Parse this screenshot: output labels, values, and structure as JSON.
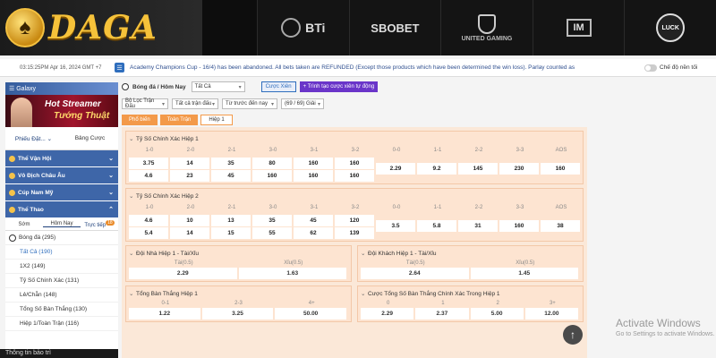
{
  "header": {
    "logo_text": "DAGA",
    "brands": [
      "BTi",
      "SBOBET",
      "UNITED GAMING",
      "IM",
      "LUCK"
    ]
  },
  "announcement": {
    "timestamp": "03:15:25PM Apr 16, 2024 GMT +7",
    "text": "Academy Champions Cup - 16/4) has been abandoned. All bets taken are REFUNDED (Except those products which have been determined the win loss). Parlay counted as",
    "toggle_label": "Chế độ nền tối"
  },
  "sidebar": {
    "galaxy_label": "Galaxy",
    "banner_line1": "Hot Streamer",
    "banner_line2": "Tướng Thuật",
    "tabs": [
      "Phiếu Đặt...",
      "Bảng Cược"
    ],
    "sections": [
      "Thể Vận Hội",
      "Vô Địch Châu Âu",
      "Cúp Nam Mỹ",
      "Thể Thao"
    ],
    "sub_tabs": [
      "Sớm",
      "Hôm Nay",
      "Trực tiếp"
    ],
    "live_badge": "18",
    "sport": "Bóng đá",
    "sport_count": "(295)",
    "categories": [
      "Tất Cả (190)",
      "1X2 (149)",
      "Tỷ Số Chính Xác (131)",
      "Lẻ/Chẵn (148)",
      "Tổng Số Bàn Thắng (130)",
      "Hiệp 1/Toàn Trận (116)"
    ],
    "footer": "Thông tin bảo trì"
  },
  "main": {
    "title": "Bóng đá / Hôm Nay",
    "select_all": "Tất Cả",
    "parlay_btn": "Cược Xiên",
    "auto_btn": "Trình tạo cược xiên tự động",
    "filters": [
      "Bộ Lọc Trận Đấu",
      "Tất cả trận đấu",
      "Từ trước đến nay",
      "(69 / 69) Giải"
    ],
    "sub_tabs": [
      "Phổ biến",
      "Toàn Trận",
      "Hiệp 1"
    ]
  },
  "correct_score_1": {
    "title": "Tỷ Số Chính Xác Hiệp 1",
    "home_headers": [
      "1-0",
      "2-0",
      "2-1",
      "3-0",
      "3-1",
      "3-2"
    ],
    "home_row1": [
      "3.75",
      "14",
      "35",
      "80",
      "160",
      "160"
    ],
    "home_row2": [
      "4.6",
      "23",
      "45",
      "160",
      "160",
      "160"
    ],
    "draw_headers": [
      "0-0",
      "1-1",
      "2-2",
      "3-3",
      "AOS"
    ],
    "draw_row": [
      "2.29",
      "9.2",
      "145",
      "230",
      "160"
    ]
  },
  "correct_score_2": {
    "title": "Tỷ Số Chính Xác Hiệp 2",
    "home_headers": [
      "1-0",
      "2-0",
      "2-1",
      "3-0",
      "3-1",
      "3-2"
    ],
    "home_row1": [
      "4.6",
      "10",
      "13",
      "35",
      "45",
      "120"
    ],
    "home_row2": [
      "5.4",
      "14",
      "15",
      "55",
      "62",
      "139"
    ],
    "draw_headers": [
      "0-0",
      "1-1",
      "2-2",
      "3-3",
      "AOS"
    ],
    "draw_row": [
      "3.5",
      "5.8",
      "31",
      "160",
      "38"
    ]
  },
  "ou_home": {
    "title": "Đội Nhà Hiệp 1 - Tài/Xỉu",
    "labels": [
      "Tài(0.5)",
      "Xỉu(0.5)"
    ],
    "odds": [
      "2.29",
      "1.63"
    ]
  },
  "ou_away": {
    "title": "Đội Khách Hiệp 1 - Tài/Xỉu",
    "labels": [
      "Tài(0.5)",
      "Xỉu(0.5)"
    ],
    "odds": [
      "2.64",
      "1.45"
    ]
  },
  "total_goals": {
    "title": "Tổng Bàn Thắng Hiệp 1",
    "labels": [
      "0-1",
      "2-3",
      "4+"
    ],
    "odds": [
      "1.22",
      "3.25",
      "50.00"
    ]
  },
  "exact_total": {
    "title": "Cược Tổng Số Bàn Thắng Chính Xác Trong Hiệp 1",
    "labels": [
      "0",
      "1",
      "2",
      "3+"
    ],
    "odds": [
      "2.29",
      "2.37",
      "5.00",
      "12.00"
    ]
  },
  "watermark": {
    "line1": "Activate Windows",
    "line2": "Go to Settings to activate Windows."
  }
}
